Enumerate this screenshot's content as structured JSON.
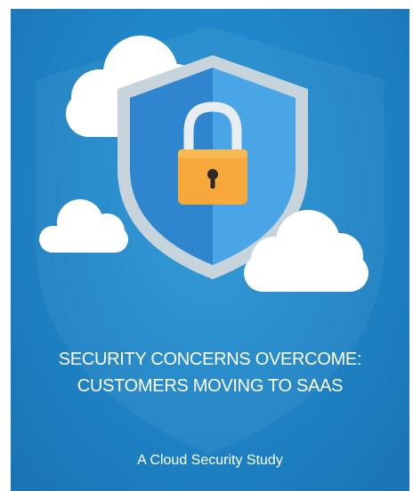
{
  "cover": {
    "title_line1": "SECURITY CONCERNS OVERCOME:",
    "title_line2": "CUSTOMERS MOVING TO SAAS",
    "subtitle": "A Cloud Security Study"
  },
  "illustration": {
    "icons": [
      "cloud-icon",
      "shield-icon",
      "padlock-icon"
    ],
    "colors": {
      "background": "#1f86c8",
      "shield_outer": "#c8d4dc",
      "shield_left": "#2f86cf",
      "shield_right": "#4aa5e6",
      "padlock_body": "#f6a83a",
      "padlock_shackle": "#e8edf0",
      "cloud": "#ffffff"
    }
  }
}
